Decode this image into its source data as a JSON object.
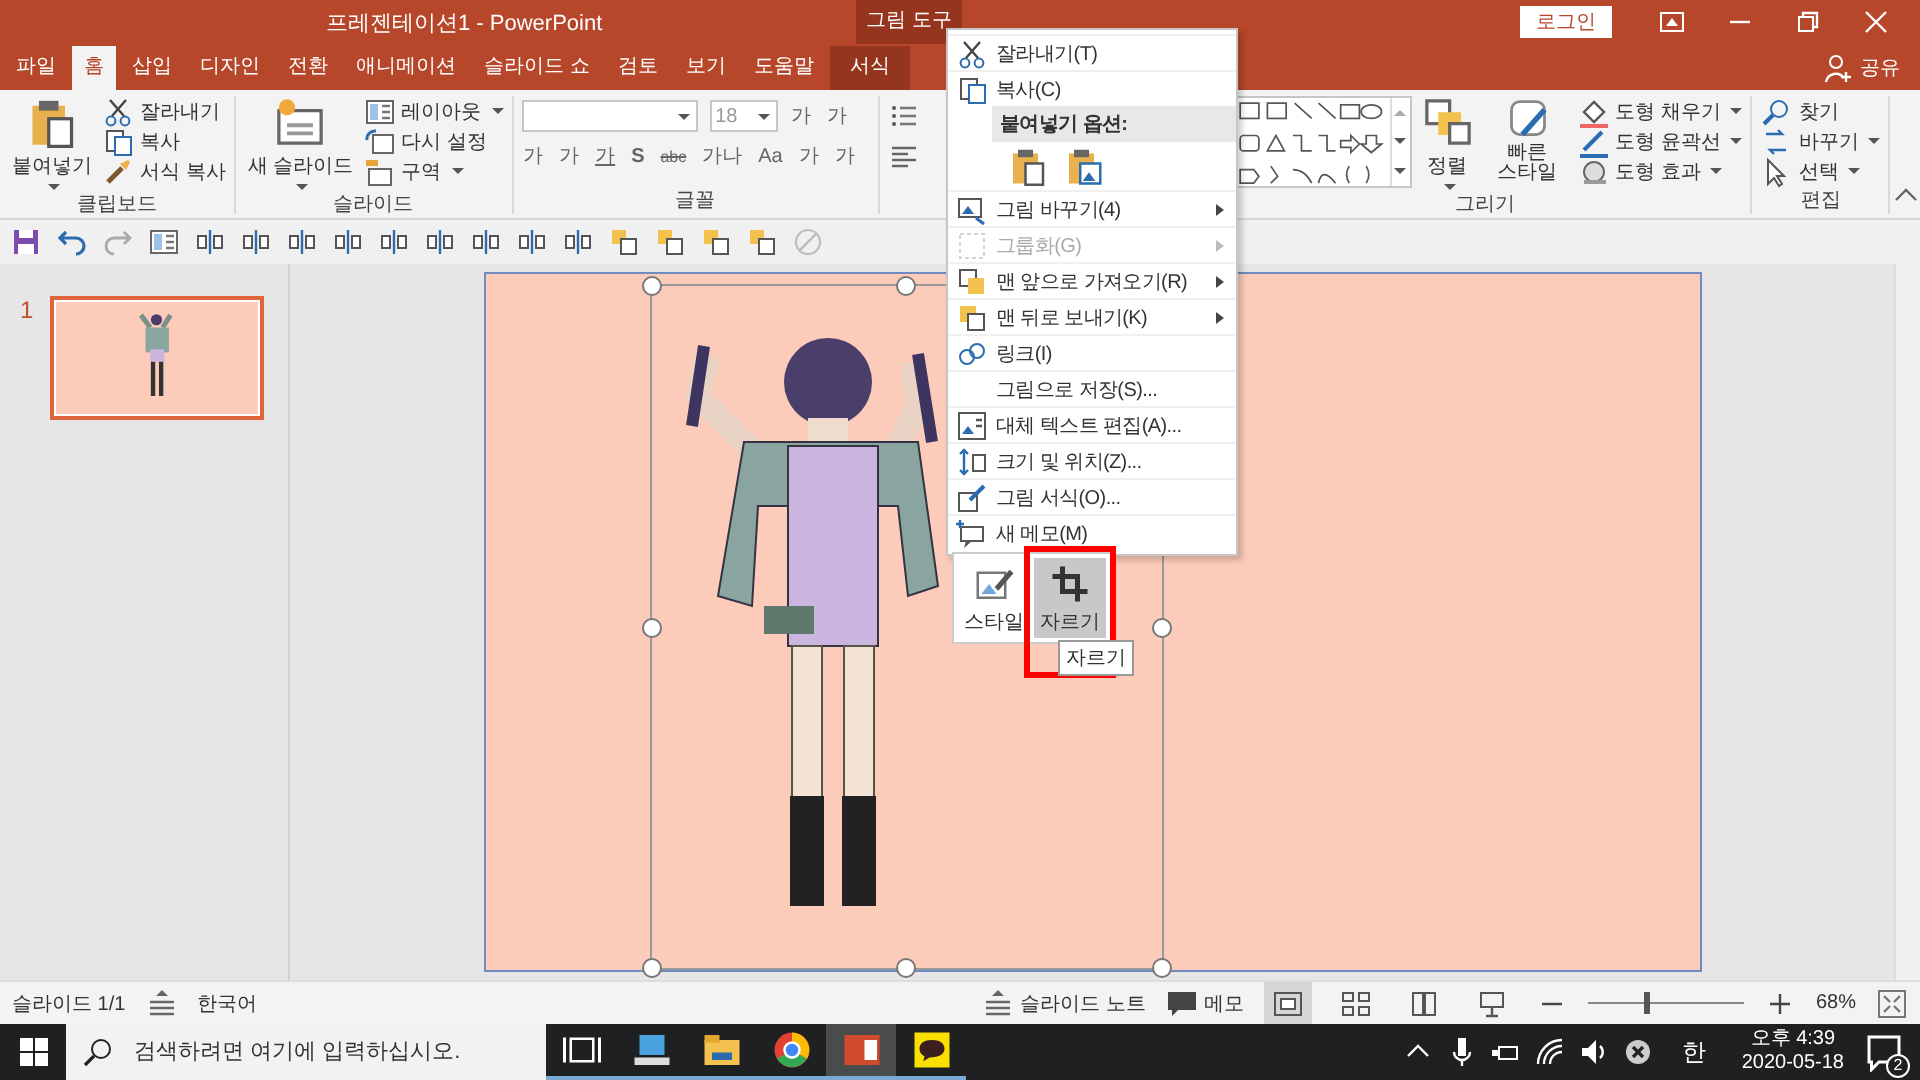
{
  "window": {
    "title": "프레젠테이션1  -  PowerPoint",
    "context_group": "그림 도구",
    "login": "로그인",
    "share": "공유"
  },
  "tabs": [
    {
      "label": "파일",
      "selected": false,
      "kind": "normal"
    },
    {
      "label": "홈",
      "selected": true,
      "kind": "normal"
    },
    {
      "label": "삽입",
      "selected": false,
      "kind": "normal"
    },
    {
      "label": "디자인",
      "selected": false,
      "kind": "normal"
    },
    {
      "label": "전환",
      "selected": false,
      "kind": "normal"
    },
    {
      "label": "애니메이션",
      "selected": false,
      "kind": "normal"
    },
    {
      "label": "슬라이드 쇼",
      "selected": false,
      "kind": "normal"
    },
    {
      "label": "검토",
      "selected": false,
      "kind": "normal"
    },
    {
      "label": "보기",
      "selected": false,
      "kind": "normal"
    },
    {
      "label": "도움말",
      "selected": false,
      "kind": "normal"
    },
    {
      "label": "서식",
      "selected": false,
      "kind": "context"
    }
  ],
  "ribbon": {
    "clipboard": {
      "label": "클립보드",
      "large": "붙여넣기",
      "items": [
        "잘라내기",
        "복사",
        "서식 복사"
      ]
    },
    "slides": {
      "label": "슬라이드",
      "large": "새 슬라이드",
      "items": [
        "레이아웃",
        "다시 설정",
        "구역"
      ]
    },
    "font": {
      "label": "글꼴",
      "size": "18",
      "size_buttons": [
        "가",
        "가"
      ],
      "buttons": [
        "가",
        "가",
        "가",
        "S",
        "abc",
        "가나",
        "Aa",
        "가",
        "가"
      ]
    },
    "drawing": {
      "label": "그리기",
      "arrange": "정렬",
      "quick_styles": "빠른 스타일",
      "items": [
        "도형 채우기",
        "도형 윤곽선",
        "도형 효과"
      ]
    },
    "editing": {
      "label": "편집",
      "items": [
        "찾기",
        "바꾸기",
        "선택"
      ]
    }
  },
  "slides": [
    {
      "number": "1",
      "selected": true
    }
  ],
  "context_menu": [
    {
      "label": "잘라내기(T)",
      "kind": "item",
      "disabled": false,
      "submenu": false
    },
    {
      "label": "복사(C)",
      "kind": "item",
      "disabled": false,
      "submenu": false
    },
    {
      "label": "붙여넣기 옵션:",
      "kind": "header"
    },
    {
      "kind": "paste-options"
    },
    {
      "label": "그림 바꾸기(4)",
      "kind": "item",
      "disabled": false,
      "submenu": true
    },
    {
      "label": "그룹화(G)",
      "kind": "item",
      "disabled": true,
      "submenu": true
    },
    {
      "label": "맨 앞으로 가져오기(R)",
      "kind": "item",
      "disabled": false,
      "submenu": true
    },
    {
      "label": "맨 뒤로 보내기(K)",
      "kind": "item",
      "disabled": false,
      "submenu": true
    },
    {
      "label": "링크(I)",
      "kind": "item",
      "disabled": false,
      "submenu": false
    },
    {
      "label": "그림으로 저장(S)...",
      "kind": "item",
      "disabled": false,
      "submenu": false
    },
    {
      "label": "대체 텍스트 편집(A)...",
      "kind": "item",
      "disabled": false,
      "submenu": false
    },
    {
      "label": "크기 및 위치(Z)...",
      "kind": "item",
      "disabled": false,
      "submenu": false
    },
    {
      "label": "그림 서식(O)...",
      "kind": "item",
      "disabled": false,
      "submenu": false
    },
    {
      "label": "새 메모(M)",
      "kind": "item",
      "disabled": false,
      "submenu": false
    }
  ],
  "mini_toolbar": {
    "buttons": [
      {
        "label": "스타일",
        "highlighted": false
      },
      {
        "label": "자르기",
        "highlighted": true
      }
    ],
    "tooltip": "자르기"
  },
  "status_bar": {
    "slide": "슬라이드 1/1",
    "language": "한국어",
    "notes": "슬라이드 노트",
    "comments": "메모",
    "views": [
      {
        "selected": true
      },
      {
        "selected": false
      },
      {
        "selected": false
      },
      {
        "selected": false
      }
    ],
    "zoom": {
      "level": 0.37,
      "reading": "68%"
    }
  },
  "taskbar": {
    "search_placeholder": "검색하려면 여기에 입력하십시오.",
    "apps": [
      {
        "kind": "task-view",
        "selected": false
      },
      {
        "kind": "computer",
        "selected": false
      },
      {
        "kind": "folder",
        "selected": false
      },
      {
        "kind": "browser",
        "selected": false
      },
      {
        "kind": "presentation",
        "selected": true
      },
      {
        "kind": "chat",
        "selected": false
      }
    ],
    "ime": "한",
    "time": "오후 4:39",
    "date": "2020-05-18",
    "notifications": "2"
  }
}
